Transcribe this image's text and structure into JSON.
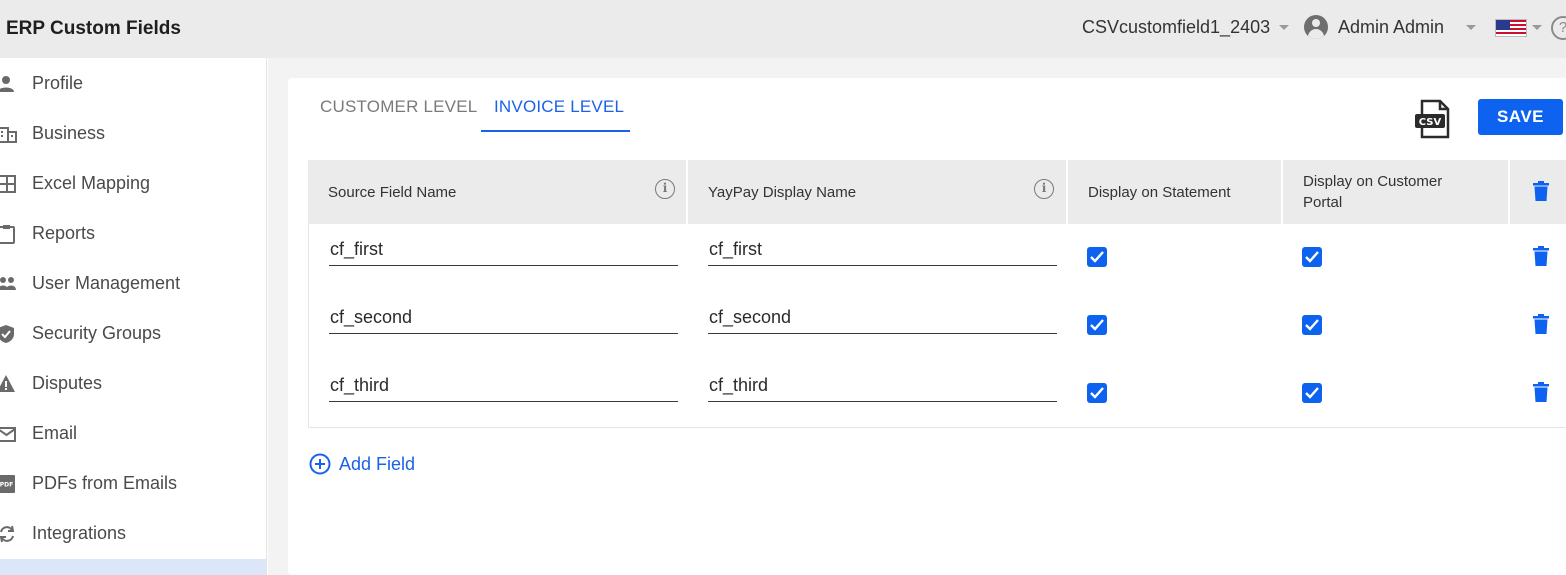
{
  "header": {
    "title": "ERP Custom Fields",
    "tenant": "CSVcustomfield1_2403",
    "user": "Admin Admin",
    "help_glyph": "?"
  },
  "sidebar": {
    "items": [
      {
        "label": "Profile",
        "icon": "person-icon"
      },
      {
        "label": "Business",
        "icon": "building-icon"
      },
      {
        "label": "Excel Mapping",
        "icon": "grid-icon"
      },
      {
        "label": "Reports",
        "icon": "clipboard-icon"
      },
      {
        "label": "User Management",
        "icon": "people-icon"
      },
      {
        "label": "Security Groups",
        "icon": "shield-icon"
      },
      {
        "label": "Disputes",
        "icon": "warning-icon"
      },
      {
        "label": "Email",
        "icon": "mail-icon"
      },
      {
        "label": "PDFs from Emails",
        "icon": "pdf-icon"
      },
      {
        "label": "Integrations",
        "icon": "sync-icon"
      }
    ]
  },
  "tabs": [
    {
      "label": "CUSTOMER LEVEL",
      "active": false
    },
    {
      "label": "INVOICE LEVEL",
      "active": true
    }
  ],
  "toolbar": {
    "csv_icon_text": "CSV",
    "save_label": "SAVE"
  },
  "table": {
    "columns": {
      "source": "Source Field Name",
      "display": "YayPay Display Name",
      "statement": "Display on Statement",
      "portal_line1": "Display on Customer",
      "portal_line2": "Portal"
    },
    "info_glyph": "i",
    "rows": [
      {
        "source": "cf_first",
        "display": "cf_first",
        "statement": true,
        "portal": true
      },
      {
        "source": "cf_second",
        "display": "cf_second",
        "statement": true,
        "portal": true
      },
      {
        "source": "cf_third",
        "display": "cf_third",
        "statement": true,
        "portal": true
      }
    ]
  },
  "add_field_label": "Add Field",
  "colors": {
    "accent": "#1a62e8",
    "button": "#0d62f0",
    "header_bg": "#ebebeb"
  }
}
